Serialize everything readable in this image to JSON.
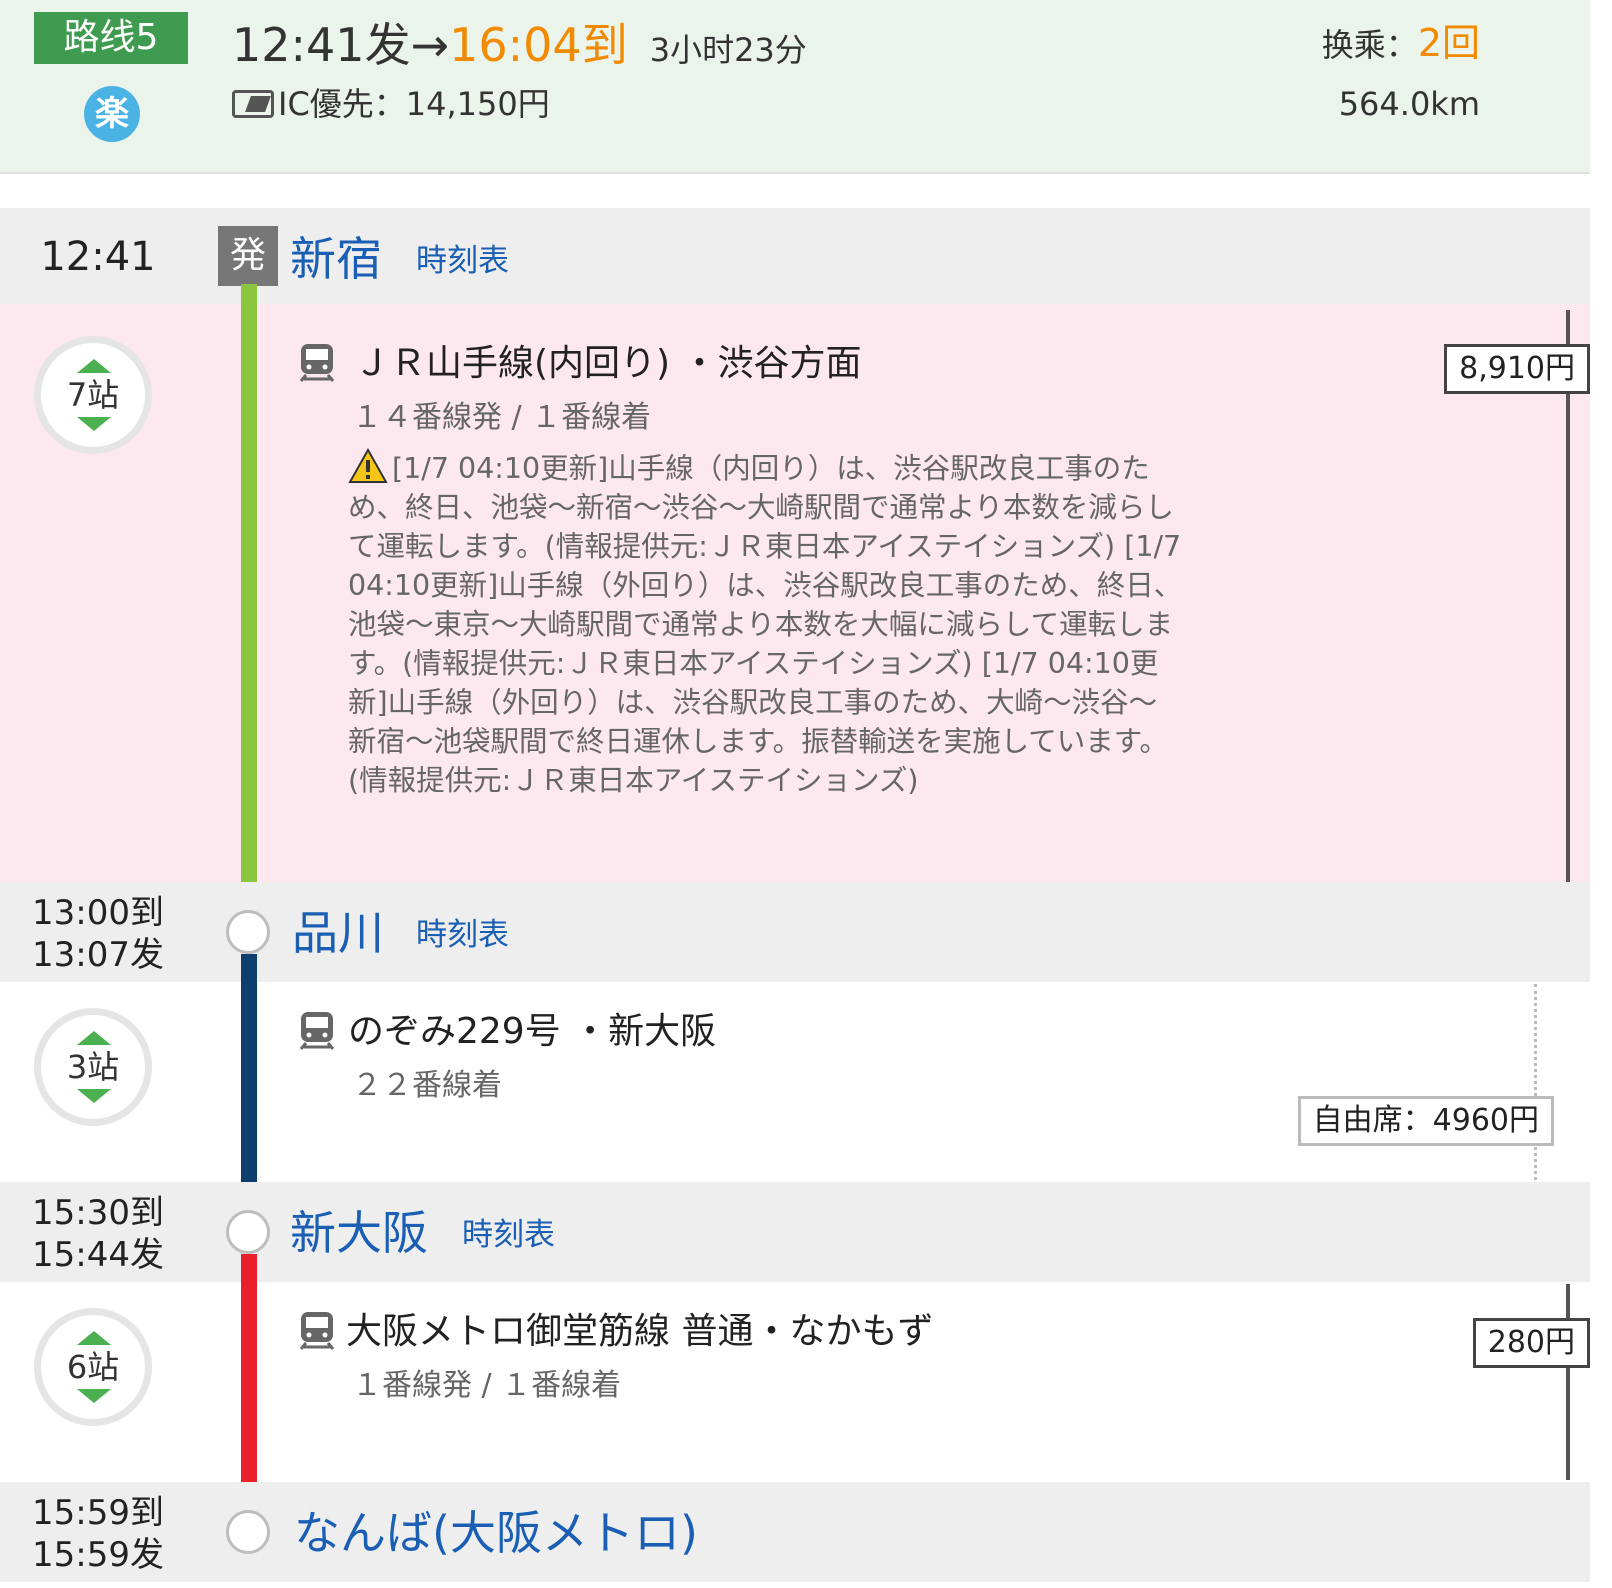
{
  "summary": {
    "route_label": "路线5",
    "comfort_icon": "楽",
    "depart": "12:41发",
    "arrow": "→",
    "arrive": "16:04到",
    "duration": "3小时23分",
    "fare_text": "IC優先：14,150円",
    "transfer_label": "换乘：",
    "transfer_count": "2回",
    "distance": "564.0km"
  },
  "stations": [
    {
      "arr": "",
      "dep": "12:41",
      "name": "新宿",
      "timetable": "時刻表",
      "badge": "発"
    },
    {
      "arr": "13:00到",
      "dep": "13:07发",
      "name": "品川",
      "timetable": "時刻表"
    },
    {
      "arr": "15:30到",
      "dep": "15:44发",
      "name": "新大阪",
      "timetable": "時刻表"
    },
    {
      "arr": "15:59到",
      "dep": "15:59发",
      "name": "なんば(大阪メトロ)",
      "timetable": ""
    }
  ],
  "sections": [
    {
      "stops": "7站",
      "line": "ＪＲ山手線(内回り) ・渋谷方面",
      "platform": "１４番線発 / １番線着",
      "fare": "8,910円",
      "color": "#8cc63f",
      "notice": "[1/7 04:10更新]山手線（内回り）は、渋谷駅改良工事のため、終日、池袋～新宿～渋谷～大崎駅間で通常より本数を減らして運転します。(情報提供元:ＪＲ東日本アイステイションズ) [1/7 04:10更新]山手線（外回り）は、渋谷駅改良工事のため、終日、池袋～東京～大崎駅間で通常より本数を大幅に減らして運転します。(情報提供元:ＪＲ東日本アイステイションズ) [1/7 04:10更新]山手線（外回り）は、渋谷駅改良工事のため、大崎～渋谷～新宿～池袋駅間で終日運休します。振替輸送を実施しています。(情報提供元:ＪＲ東日本アイステイションズ)"
    },
    {
      "stops": "3站",
      "line": "のぞみ229号 ・新大阪",
      "platform": "２２番線着",
      "fare": "自由席：4960円",
      "color": "#0d3e6e"
    },
    {
      "stops": "6站",
      "line": "大阪メトロ御堂筋線 普通・なかもず",
      "platform": "１番線発 / １番線着",
      "fare": "280円",
      "color": "#e8202a"
    }
  ]
}
